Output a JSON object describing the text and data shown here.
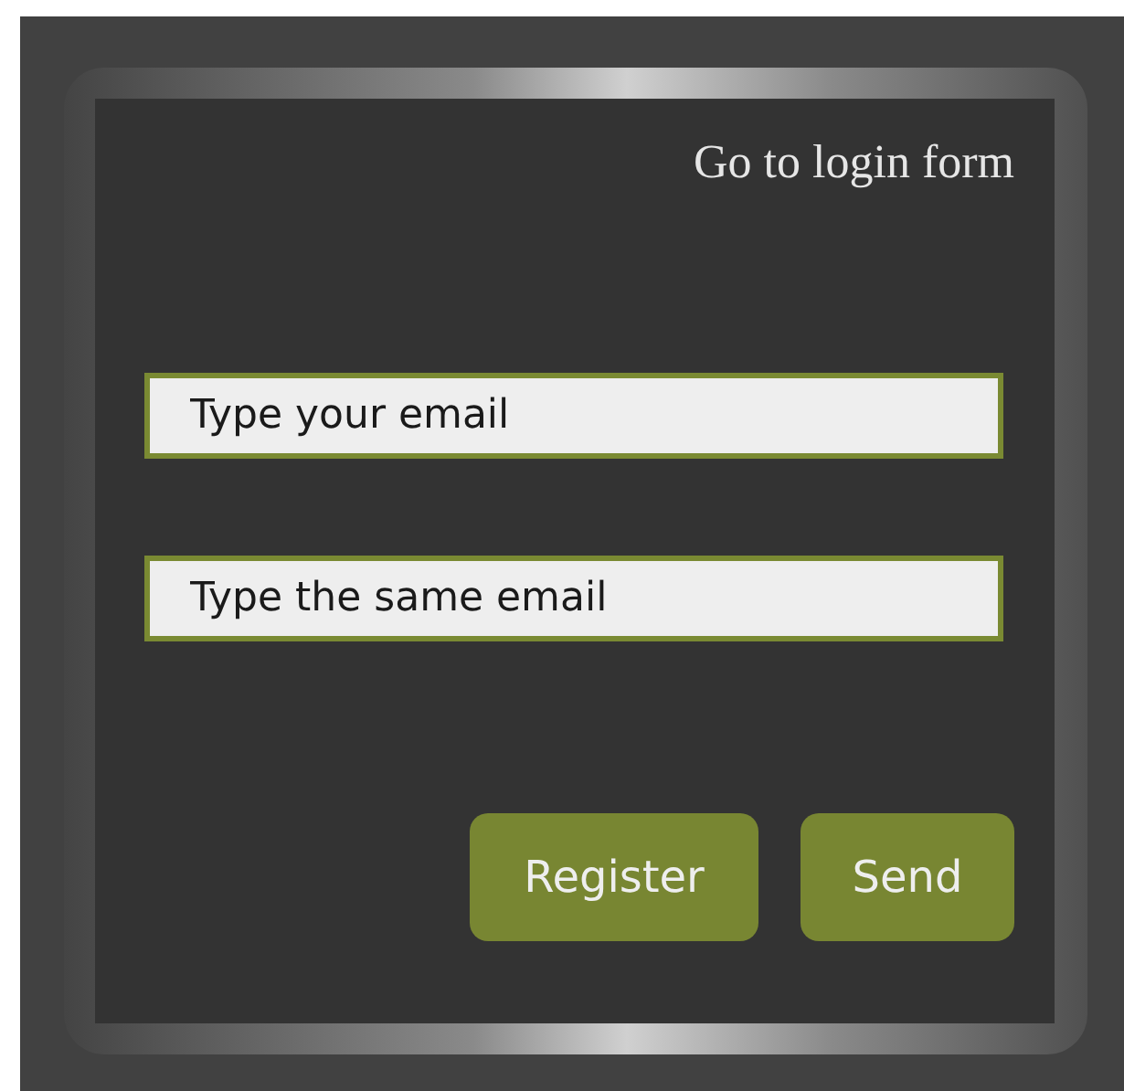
{
  "link": {
    "label": "Go to login form"
  },
  "fields": [
    {
      "placeholder": "Type your email"
    },
    {
      "placeholder": "Type the same email"
    }
  ],
  "buttons": [
    "Register",
    "Send"
  ]
}
